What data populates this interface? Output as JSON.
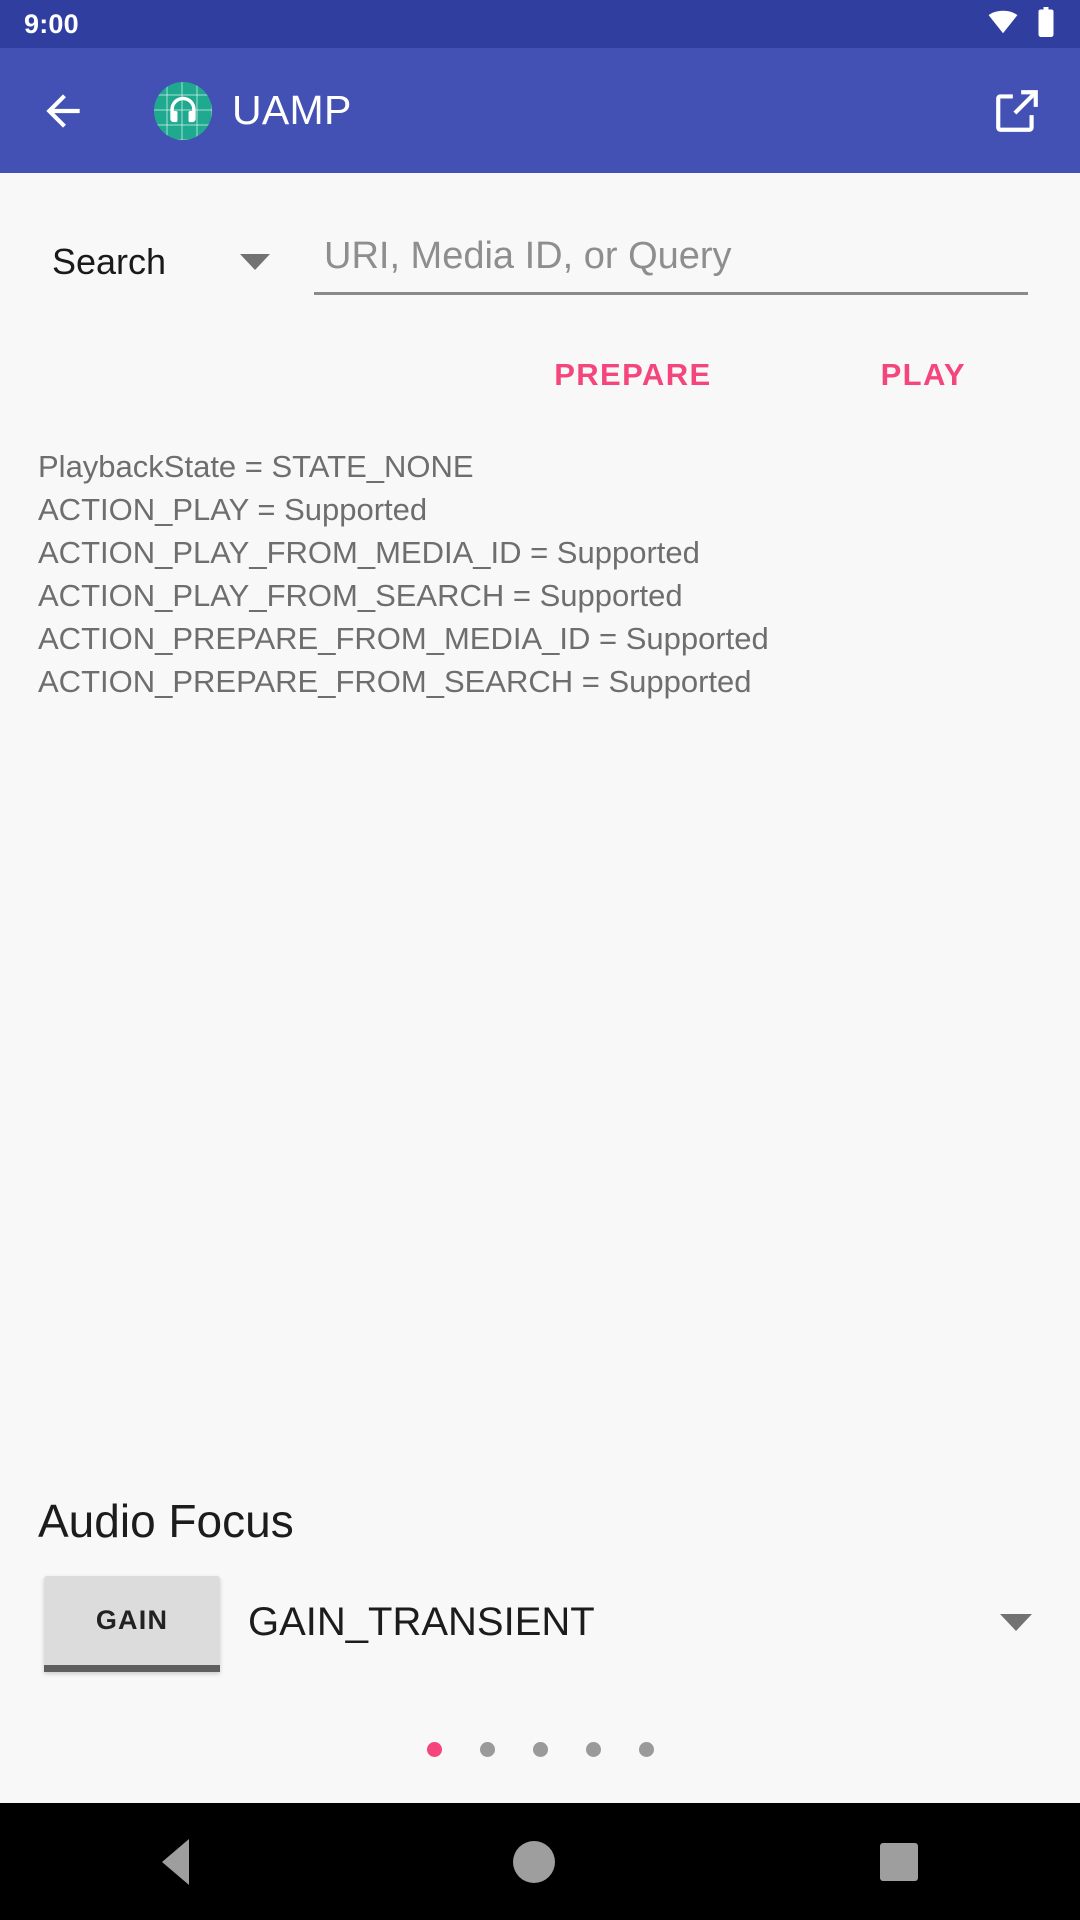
{
  "status_bar": {
    "time": "9:00",
    "icons": [
      "wifi-icon",
      "battery-icon"
    ]
  },
  "app_bar": {
    "back_icon": "arrow-back-icon",
    "app_icon": "uamp-headphones-icon",
    "title": "UAMP",
    "action_icon": "open-in-new-icon",
    "background_color": "#4351B4"
  },
  "search": {
    "type_label": "Search",
    "type_caret_icon": "chevron-down-icon",
    "placeholder": "URI, Media ID, or Query",
    "value": ""
  },
  "actions": {
    "prepare_label": "PREPARE",
    "play_label": "PLAY",
    "accent_color": "#F5457D"
  },
  "playback_state": {
    "lines": [
      "PlaybackState = STATE_NONE",
      "ACTION_PLAY = Supported",
      "ACTION_PLAY_FROM_MEDIA_ID = Supported",
      "ACTION_PLAY_FROM_SEARCH = Supported",
      "ACTION_PREPARE_FROM_MEDIA_ID = Supported",
      "ACTION_PREPARE_FROM_SEARCH = Supported"
    ]
  },
  "audio_focus": {
    "title": "Audio Focus",
    "request_button_label": "GAIN",
    "selected_focus_type": "GAIN_TRANSIENT",
    "caret_icon": "chevron-down-icon"
  },
  "pager": {
    "total": 5,
    "active_index": 0,
    "active_color": "#F5457D",
    "inactive_color": "#9A9A9A"
  },
  "nav_bar": {
    "back_icon": "nav-back-triangle-icon",
    "home_icon": "nav-home-circle-icon",
    "recents_icon": "nav-recents-square-icon"
  }
}
